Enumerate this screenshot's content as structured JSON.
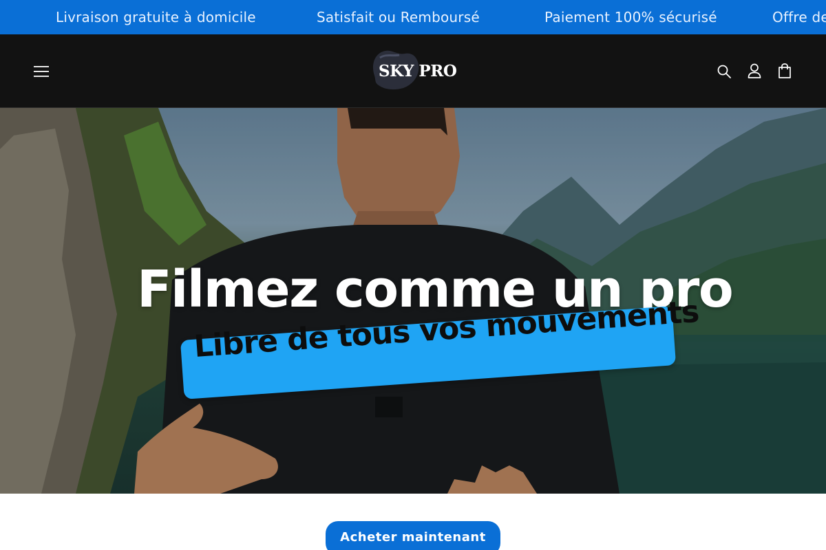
{
  "announcement_bar": {
    "messages": [
      "Livraison gratuite à domicile",
      "Satisfait ou Remboursé",
      "Paiement 100% sécurisé",
      "Offre de"
    ],
    "background_color": "#0a6fd6"
  },
  "header": {
    "logo_text": "SKY PRO",
    "icons": [
      "menu-icon",
      "search-icon",
      "account-icon",
      "cart-icon"
    ],
    "background_color": "#121212"
  },
  "hero": {
    "headline": "Filmez comme un pro",
    "tagline": "Libre de tous vos mouvements",
    "tagline_color": "#1fa4f4"
  },
  "cta": {
    "label": "Acheter maintenant",
    "color": "#0a6fd6"
  }
}
